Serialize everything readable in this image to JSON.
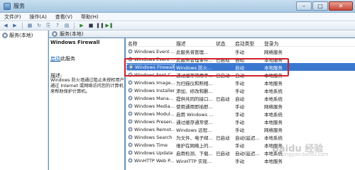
{
  "window": {
    "title": "服务",
    "buttons": [
      "–",
      "□",
      "✕"
    ]
  },
  "menu": [
    "文件(F)",
    "操作(A)",
    "查看(V)",
    "帮助(H)"
  ],
  "nav": {
    "item": "服务(本地)"
  },
  "pane_header": "服务(本地)",
  "detail": {
    "title": "Windows Firewall",
    "link": "启动",
    "link_suffix": "此服务",
    "desc_label": "描述:",
    "desc": "Windows 防火墙通过阻止未授权用户通过 Internet 或网络访问您的计算机来帮助保护计算机。"
  },
  "columns": [
    "名称",
    "描述",
    "状态",
    "启动类型",
    "登录为"
  ],
  "services": [
    {
      "name": "Windows Event ...",
      "desc": "此服务将管理...",
      "status": "",
      "startup": "手动",
      "logon": "网络服务"
    },
    {
      "name": "Windows Event ...",
      "desc": "此服务管理事件...",
      "status": "已启动",
      "startup": "自动",
      "logon": "本地服务"
    },
    {
      "name": "Windows Firewall",
      "desc": "Windows 防火...",
      "status": "",
      "startup": "自动",
      "logon": "本地服务"
    },
    {
      "name": "Windows Font C...",
      "desc": "通过缓存常用字...",
      "status": "已启动",
      "startup": "自动",
      "logon": "本地服务"
    },
    {
      "name": "Windows Image...",
      "desc": "为扫描仪和照相...",
      "status": "",
      "startup": "手动",
      "logon": "本地服务"
    },
    {
      "name": "Windows Installer",
      "desc": "添加、修改和删...",
      "status": "",
      "startup": "手动",
      "logon": "本地系统"
    },
    {
      "name": "Windows Mana...",
      "desc": "提供共同的接口...",
      "status": "已启动",
      "startup": "自动",
      "logon": "本地系统"
    },
    {
      "name": "Windows Media...",
      "desc": "使用通用即插即...",
      "status": "",
      "startup": "手动",
      "logon": "网络服务"
    },
    {
      "name": "Windows Modul...",
      "desc": "启用 Windows ...",
      "status": "",
      "startup": "手动",
      "logon": "本地系统"
    },
    {
      "name": "Windows Presen...",
      "desc": "通过缓存通常使...",
      "status": "",
      "startup": "手动",
      "logon": "本地服务"
    },
    {
      "name": "Windows Remot...",
      "desc": "Windows 远程...",
      "status": "",
      "startup": "手动",
      "logon": "网络服务"
    },
    {
      "name": "Windows Search",
      "desc": "为文件、电子邮...",
      "status": "已启动",
      "startup": "自动(延迟...",
      "logon": "本地系统"
    },
    {
      "name": "Windows Time",
      "desc": "维护在网络上的...",
      "status": "",
      "startup": "手动",
      "logon": "本地服务"
    },
    {
      "name": "Windows Update",
      "desc": "启用检测、下载...",
      "status": "已启动",
      "startup": "自动(延迟...",
      "logon": "本地系统"
    },
    {
      "name": "WinHTTP Web P...",
      "desc": "WinHTTP 实现...",
      "status": "",
      "startup": "手动",
      "logon": "本地服务"
    }
  ],
  "selected_index": 2,
  "watermark": {
    "main": "Baidu 经验",
    "sub": "jingyan.baidu.com"
  }
}
